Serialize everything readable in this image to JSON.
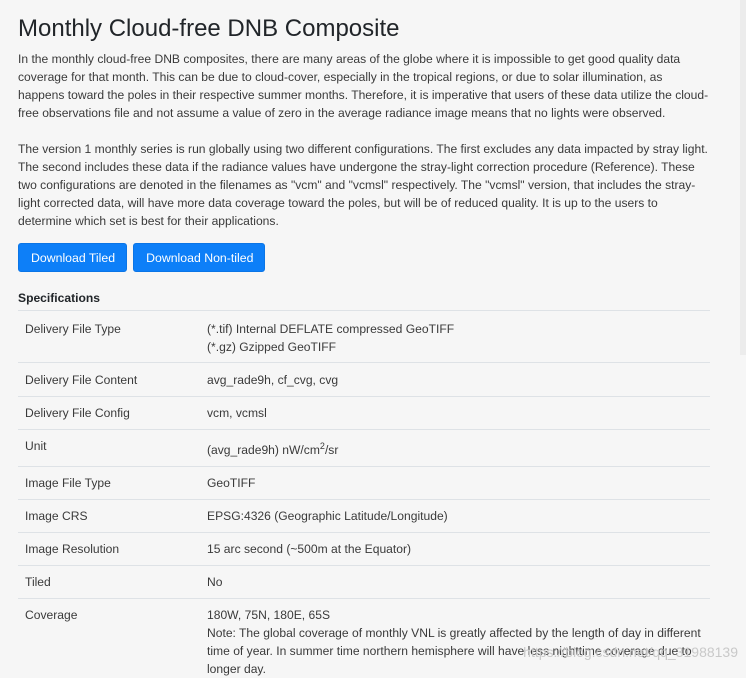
{
  "page": {
    "title": "Monthly Cloud-free DNB Composite",
    "paragraphs": [
      "In the monthly cloud-free DNB composites, there are many areas of the globe where it is impossible to get good quality data coverage for that month. This can be due to cloud-cover, especially in the tropical regions, or due to solar illumination, as happens toward the poles in their respective summer months. Therefore, it is imperative that users of these data utilize the cloud-free observations file and not assume a value of zero in the average radiance image means that no lights were observed.",
      "The version 1 monthly series is run globally using two different configurations. The first excludes any data impacted by stray light. The second includes these data if the radiance values have undergone the stray-light correction procedure (Reference). These two configurations are denoted in the filenames as \"vcm\" and \"vcmsl\" respectively. The \"vcmsl\" version, that includes the stray-light corrected data, will have more data coverage toward the poles, but will be of reduced quality. It is up to the users to determine which set is best for their applications."
    ],
    "buttons": {
      "download_tiled": "Download Tiled",
      "download_non_tiled": "Download Non-tiled"
    },
    "spec_title": "Specifications",
    "specs": [
      {
        "key": "Delivery File Type",
        "lines": [
          "(*.tif) Internal DEFLATE compressed GeoTIFF",
          "(*.gz) Gzipped GeoTIFF"
        ]
      },
      {
        "key": "Delivery File Content",
        "lines": [
          "avg_rade9h, cf_cvg, cvg"
        ]
      },
      {
        "key": "Delivery File Config",
        "lines": [
          "vcm, vcmsl"
        ]
      },
      {
        "key": "Unit",
        "unit_prefix": "(avg_rade9h) nW/cm",
        "unit_sup": "2",
        "unit_suffix": "/sr"
      },
      {
        "key": "Image File Type",
        "lines": [
          "GeoTIFF"
        ]
      },
      {
        "key": "Image CRS",
        "lines": [
          "EPSG:4326 (Geographic Latitude/Longitude)"
        ]
      },
      {
        "key": "Image Resolution",
        "lines": [
          "15 arc second (~500m at the Equator)"
        ]
      },
      {
        "key": "Tiled",
        "lines": [
          "No"
        ]
      },
      {
        "key": "Coverage",
        "lines": [
          "180W, 75N, 180E, 65S",
          "Note: The global coverage of monthly VNL is greatly affected by the length of day in different time of year. In summer time northern hemisphere will have less nighttime coverage due to longer day."
        ]
      }
    ],
    "watermark": "https://blog.csdn.net/qq_31988139"
  }
}
